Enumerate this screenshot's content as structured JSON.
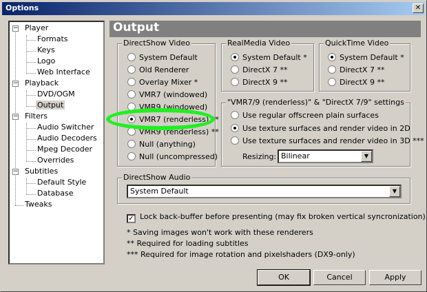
{
  "window": {
    "title": "Options",
    "close": "✕"
  },
  "tree": {
    "items": [
      {
        "label": "Player",
        "box": "−"
      },
      {
        "label": "Formats"
      },
      {
        "label": "Keys"
      },
      {
        "label": "Logo"
      },
      {
        "label": "Web Interface"
      },
      {
        "label": "Playback",
        "box": "−"
      },
      {
        "label": "DVD/OGM"
      },
      {
        "label": "Output"
      },
      {
        "label": "Filters",
        "box": "−"
      },
      {
        "label": "Audio Switcher"
      },
      {
        "label": "Audio Decoders"
      },
      {
        "label": "Mpeg Decoder"
      },
      {
        "label": "Overrides"
      },
      {
        "label": "Subtitles",
        "box": "−"
      },
      {
        "label": "Default Style"
      },
      {
        "label": "Database"
      },
      {
        "label": "Tweaks"
      }
    ]
  },
  "header": {
    "title": "Output"
  },
  "directshow_video": {
    "legend": "DirectShow Video",
    "options": [
      "System Default",
      "Old Renderer",
      "Overlay Mixer *",
      "VMR7 (windowed)",
      "VMR9 (windowed)",
      "VMR7 (renderless) **",
      "VMR9 (renderless) **",
      "Null (anything)",
      "Null (uncompressed)"
    ],
    "selected": 5
  },
  "realmedia_video": {
    "legend": "RealMedia Video",
    "options": [
      "System Default *",
      "DirectX 7 **",
      "DirectX 9 **"
    ],
    "selected": 0
  },
  "quicktime_video": {
    "legend": "QuickTime Video",
    "options": [
      "System Default *",
      "DirectX 7 **",
      "DirectX 9 **"
    ],
    "selected": 0
  },
  "vmr_settings": {
    "legend": "\"VMR7/9 (renderless)\" & \"DirectX 7/9\" settings",
    "options": [
      "Use regular offscreen plain surfaces",
      "Use texture surfaces and render video in 2D",
      "Use texture surfaces and render video in 3D ***"
    ],
    "selected": 1,
    "resizing_label": "Resizing:",
    "resizing_value": "Bilinear",
    "arrow": "▼"
  },
  "directshow_audio": {
    "legend": "DirectShow Audio",
    "value": "System Default",
    "arrow": "▼"
  },
  "lock_backbuffer": {
    "label": "Lock back-buffer before presenting (may fix broken vertical syncronization)",
    "mark": "✓"
  },
  "notes": [
    "* Saving images won't work with these renderers",
    "** Required for loading subtitles",
    "*** Required for image rotation and pixelshaders (DX9-only)"
  ],
  "buttons": {
    "ok": "OK",
    "cancel": "Cancel",
    "apply": "Apply"
  },
  "colors": {
    "titlebar": "#0a246a",
    "face": "#d4d0c8",
    "header": "#808080",
    "highlight": "#22ee22"
  }
}
